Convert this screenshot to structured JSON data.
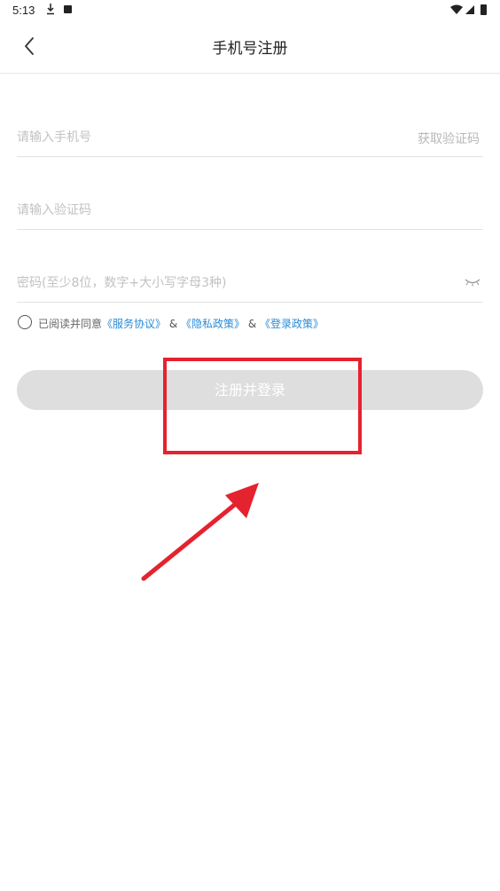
{
  "status_bar": {
    "time": "5:13"
  },
  "header": {
    "title": "手机号注册"
  },
  "form": {
    "phone_placeholder": "请输入手机号",
    "get_code_label": "获取验证码",
    "code_placeholder": "请输入验证码",
    "password_placeholder": "密码(至少8位，数字+大小写字母3种)"
  },
  "agreement": {
    "prefix": "已阅读并同意",
    "service_link": "《服务协议》",
    "separator1": " & ",
    "privacy_link": "《隐私政策》",
    "separator2": " & ",
    "login_link": "《登录政策》"
  },
  "register_button": {
    "label": "注册并登录"
  },
  "annotation": {
    "color": "#e5222f"
  }
}
